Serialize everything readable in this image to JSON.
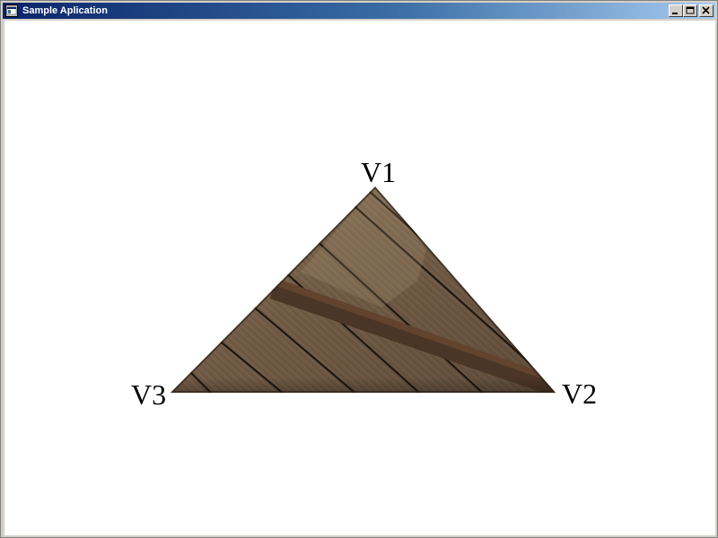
{
  "window": {
    "title": "Sample Aplication",
    "icon": "app-window-icon",
    "controls": {
      "minimize_icon": "minimize-icon",
      "maximize_icon": "maximize-icon",
      "close_icon": "close-icon"
    }
  },
  "scene": {
    "background_color": "#ffffff",
    "texture": "wood-planks",
    "vertices": [
      {
        "label": "V1"
      },
      {
        "label": "V2"
      },
      {
        "label": "V3"
      }
    ]
  }
}
